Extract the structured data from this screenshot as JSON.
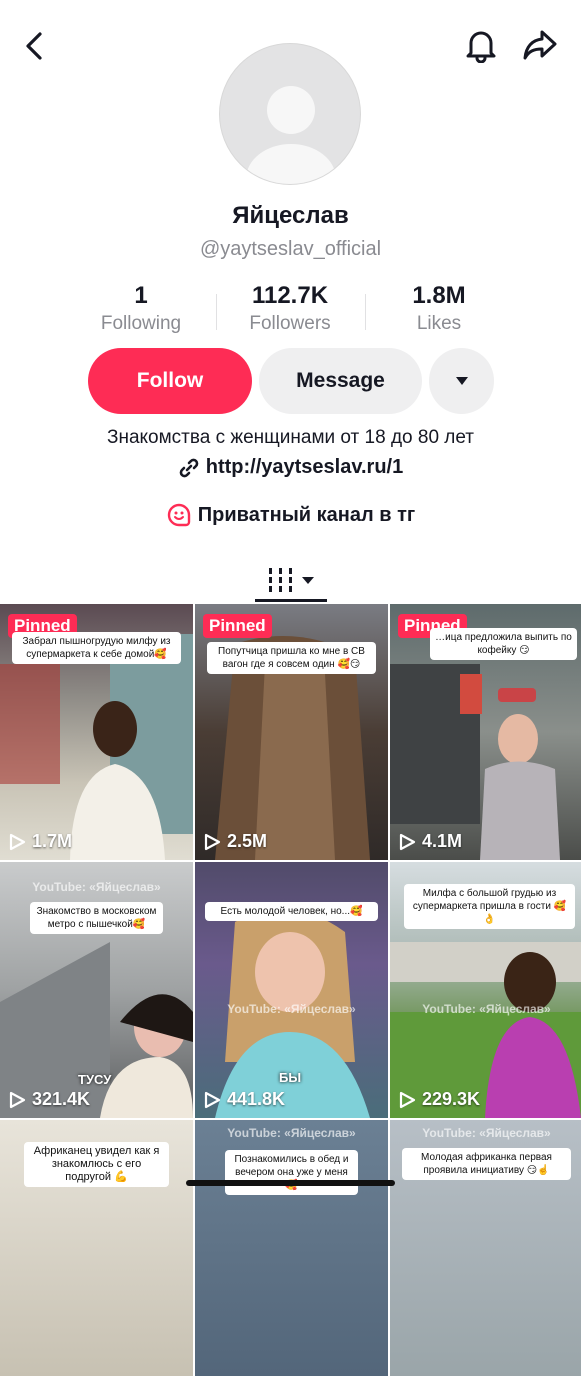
{
  "profile": {
    "display_name": "Яйцеслав",
    "username": "@yaytseslav_official"
  },
  "stats": [
    {
      "value": "1",
      "label": "Following"
    },
    {
      "value": "112.7K",
      "label": "Followers"
    },
    {
      "value": "1.8M",
      "label": "Likes"
    }
  ],
  "actions": {
    "follow_label": "Follow",
    "message_label": "Message"
  },
  "bio": {
    "text": "Знакомства с женщинами от 18 до 80 лет",
    "link": "http://yaytseslav.ru/1",
    "channel": "Приватный канал в тг"
  },
  "colors": {
    "accent": "#fe2c55",
    "text": "#161823",
    "muted": "#8a8b91"
  },
  "videos": [
    {
      "pinned": "Pinned",
      "caption": "Забрал пышногрудую милфу из супермаркета к себе домой🥰",
      "views": "1.7M",
      "watermark": "",
      "subtitle": ""
    },
    {
      "pinned": "Pinned",
      "caption": "Попутчица пришла ко мне в СВ вагон где я совсем один 🥰😏",
      "views": "2.5M",
      "watermark": "",
      "subtitle": ""
    },
    {
      "pinned": "Pinned",
      "caption": "…ица предложила выпить по кофейку 😏",
      "views": "4.1M",
      "watermark": "",
      "subtitle": ""
    },
    {
      "pinned": "",
      "caption": "Знакомство в московском метро с пышечкой🥰",
      "views": "321.4K",
      "watermark": "YouTube: «Яйцеслав»",
      "subtitle": "ТУСУ"
    },
    {
      "pinned": "",
      "caption": "Есть молодой человек, но...🥰",
      "views": "441.8K",
      "watermark": "YouTube: «Яйцеслав»",
      "subtitle": "БЫ"
    },
    {
      "pinned": "",
      "caption": "Милфа с большой грудью из супермаркета пришла в гости 🥰👌",
      "views": "229.3K",
      "watermark": "YouTube: «Яйцеслав»",
      "subtitle": ""
    },
    {
      "pinned": "",
      "caption": "Африканец увидел как я знакомлюсь с его подругой 💪",
      "views": "",
      "watermark": "",
      "subtitle": ""
    },
    {
      "pinned": "",
      "caption": "Познакомились в обед и вечером она уже у меня🥰",
      "views": "",
      "watermark": "YouTube: «Яйцеслав»",
      "subtitle": ""
    },
    {
      "pinned": "",
      "caption": "Молодая африканка первая проявила инициативу 😏☝️",
      "views": "",
      "watermark": "YouTube: «Яйцеслав»",
      "subtitle": ""
    }
  ]
}
